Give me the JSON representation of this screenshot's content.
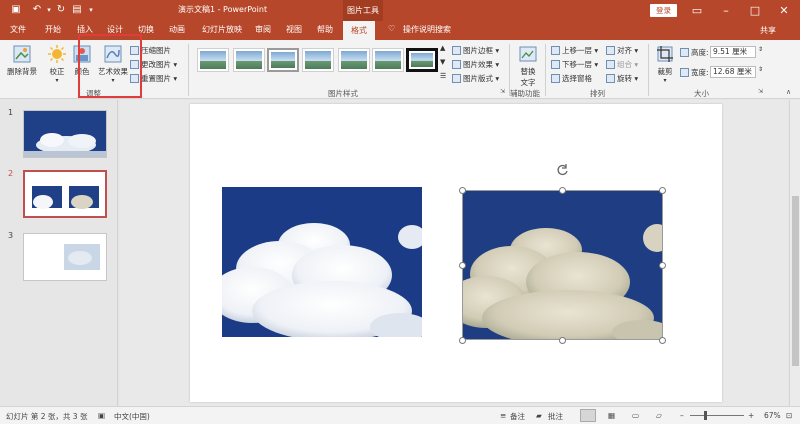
{
  "titlebar": {
    "title": "演示文稿1 - PowerPoint",
    "tool_tab": "图片工具",
    "login": "登录"
  },
  "tabs": [
    "文件",
    "开始",
    "插入",
    "设计",
    "切换",
    "动画",
    "幻灯片放映",
    "审阅",
    "视图",
    "帮助",
    "格式"
  ],
  "active_tab": "格式",
  "tell_me": "操作说明搜索",
  "share": "共享",
  "ribbon": {
    "adjust": {
      "remove_bg": "删除背景",
      "corrections": "校正",
      "color": "颜色",
      "artistic": "艺术效果",
      "compress": "压缩图片",
      "change": "更改图片",
      "reset": "重置图片",
      "group_label": "调整"
    },
    "styles": {
      "border": "图片边框",
      "effects": "图片效果",
      "layout": "图片版式",
      "group_label": "图片样式"
    },
    "accessibility": {
      "alt_text_line1": "替换",
      "alt_text_line2": "文字",
      "group_label": "辅助功能"
    },
    "arrange": {
      "bring_forward": "上移一层",
      "send_backward": "下移一层",
      "selection_pane": "选择窗格",
      "align": "对齐",
      "group": "组合",
      "rotate": "旋转",
      "group_label": "排列"
    },
    "size": {
      "crop": "裁剪",
      "height_label": "高度:",
      "height_value": "9.51 厘米",
      "width_label": "宽度:",
      "width_value": "12.68 厘米",
      "group_label": "大小"
    }
  },
  "slides": [
    {
      "number": "1"
    },
    {
      "number": "2"
    },
    {
      "number": "3"
    }
  ],
  "statusbar": {
    "slide_info": "幻灯片 第 2 张，共 3 张",
    "language": "中文(中国)",
    "notes": "备注",
    "comments": "批注",
    "zoom": "67%"
  },
  "colors": {
    "brand": "#b7472a",
    "highlight": "#e03c3c",
    "sky": "#1f3f87"
  }
}
